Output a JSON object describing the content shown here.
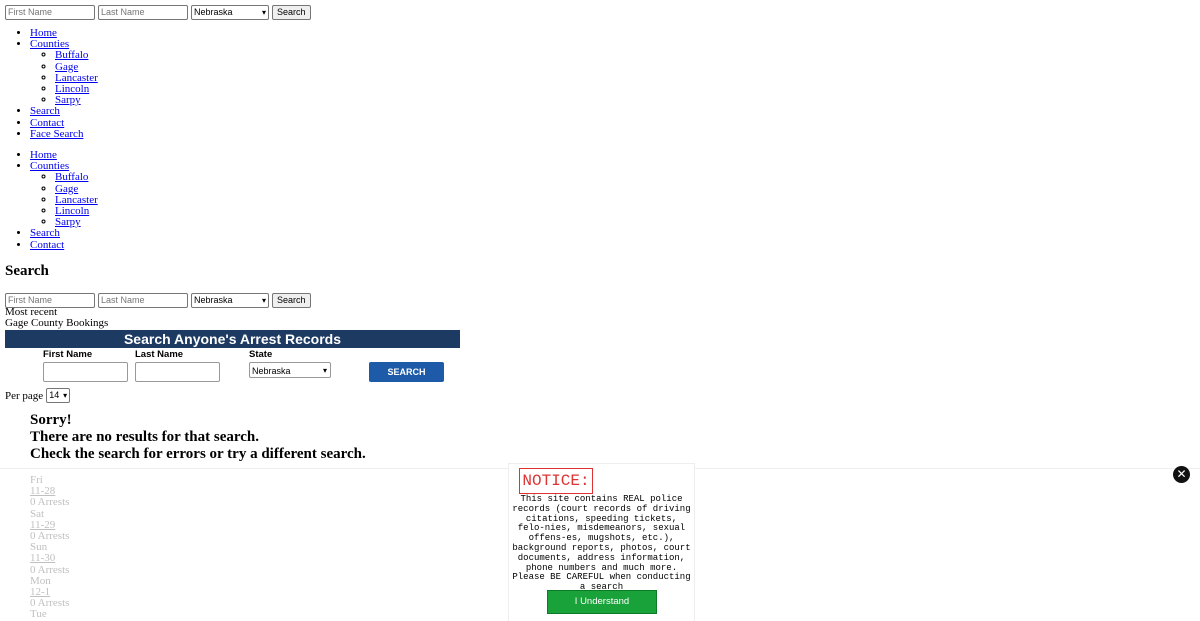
{
  "top_search": {
    "first_placeholder": "First Name",
    "last_placeholder": "Last Name",
    "state": "Nebraska",
    "button": "Search"
  },
  "nav1": {
    "home": "Home",
    "counties": "Counties",
    "county_items": [
      "Buffalo",
      "Gage",
      "Lancaster",
      "Lincoln",
      "Sarpy"
    ],
    "search": "Search",
    "contact": "Contact",
    "face_search": "Face Search"
  },
  "nav2": {
    "home": "Home",
    "counties": "Counties",
    "county_items": [
      "Buffalo",
      "Gage",
      "Lancaster",
      "Lincoln",
      "Sarpy"
    ],
    "search": "Search",
    "contact": "Contact"
  },
  "page_heading": "Search",
  "second_search": {
    "first_placeholder": "First Name",
    "last_placeholder": "Last Name",
    "state": "Nebraska",
    "button": "Search"
  },
  "most_recent": "Most recent",
  "bookings_title": "Gage County Bookings",
  "arrest_form": {
    "title": "Search Anyone's Arrest Records",
    "first_label": "First Name",
    "last_label": "Last Name",
    "state_label": "State",
    "state_value": "Nebraska",
    "button": "SEARCH"
  },
  "per_page": {
    "label": "Per page",
    "value": "14"
  },
  "no_results": {
    "line1": "Sorry!",
    "line2": "There are no results for that search.",
    "line3": "Check the search for errors or try a different search."
  },
  "days": [
    {
      "weekday": "Fri",
      "date": "11-28",
      "count": "0 Arrests"
    },
    {
      "weekday": "Sat",
      "date": "11-29",
      "count": "0 Arrests"
    },
    {
      "weekday": "Sun",
      "date": "11-30",
      "count": "0 Arrests"
    },
    {
      "weekday": "Mon",
      "date": "12-1",
      "count": "0 Arrests"
    },
    {
      "weekday": "Tue"
    }
  ],
  "notice": {
    "title": "NOTICE:",
    "body": "This site contains REAL police records (court records of driving citations, speeding tickets, felo-nies, misdemeanors, sexual offens-es, mugshots, etc.), background reports, photos, court documents, address information, phone numbers and much more. Please BE CAREFUL when conducting a search",
    "button": "I Understand"
  },
  "close_icon": "close-icon"
}
